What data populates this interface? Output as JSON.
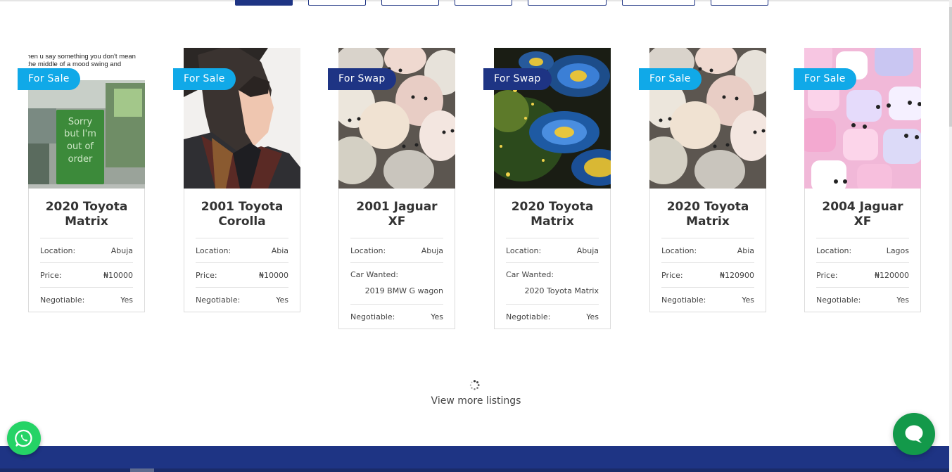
{
  "filters": {
    "tab_count": 7,
    "active_index": 0
  },
  "listings": [
    {
      "badge": "For Sale",
      "badge_type": "sale",
      "title": "2020 Toyota Matrix",
      "photo": "meme-out-of-order",
      "photo_text": [
        "hen u say something you don't mean",
        "the middle of a mood swing and",
        "Sorry",
        "but I'm",
        "out of",
        "order"
      ],
      "location_label": "Location:",
      "location": "Abuja",
      "price_label": "Price:",
      "price": "₦10000",
      "negotiable_label": "Negotiable:",
      "negotiable": "Yes"
    },
    {
      "badge": "For Sale",
      "badge_type": "sale",
      "title": "2001 Toyota Corolla",
      "photo": "anime-character",
      "location_label": "Location:",
      "location": "Abia",
      "price_label": "Price:",
      "price": "₦10000",
      "negotiable_label": "Negotiable:",
      "negotiable": "Yes"
    },
    {
      "badge": "For Swap",
      "badge_type": "swap",
      "title": "2001 Jaguar XF",
      "photo": "cute-pebbles",
      "location_label": "Location:",
      "location": "Abuja",
      "wanted_label": "Car Wanted:",
      "wanted": "2019 BMW G wagon",
      "negotiable_label": "Negotiable:",
      "negotiable": "Yes"
    },
    {
      "badge": "For Swap",
      "badge_type": "swap",
      "title": "2020 Toyota Matrix",
      "photo": "fractal-flowers",
      "location_label": "Location:",
      "location": "Abuja",
      "wanted_label": "Car Wanted:",
      "wanted": "2020 Toyota Matrix",
      "negotiable_label": "Negotiable:",
      "negotiable": "Yes"
    },
    {
      "badge": "For Sale",
      "badge_type": "sale",
      "title": "2020 Toyota Matrix",
      "photo": "cute-pebbles",
      "location_label": "Location:",
      "location": "Abia",
      "price_label": "Price:",
      "price": "₦120900",
      "negotiable_label": "Negotiable:",
      "negotiable": "Yes"
    },
    {
      "badge": "For Sale",
      "badge_type": "sale",
      "title": "2004 Jaguar XF",
      "photo": "pink-marshmallows",
      "location_label": "Location:",
      "location": "Lagos",
      "price_label": "Price:",
      "price": "₦120000",
      "negotiable_label": "Negotiable:",
      "negotiable": "Yes"
    }
  ],
  "view_more": "View more listings",
  "loader_icon": "spinner-icon",
  "whatsapp_icon": "whatsapp-icon",
  "chat_icon": "chat-bubble-icon",
  "colors": {
    "sale": "#10a9e8",
    "swap": "#1e3484",
    "footer": "#1e3484",
    "whatsapp": "#25d366",
    "chat": "#13994a"
  }
}
